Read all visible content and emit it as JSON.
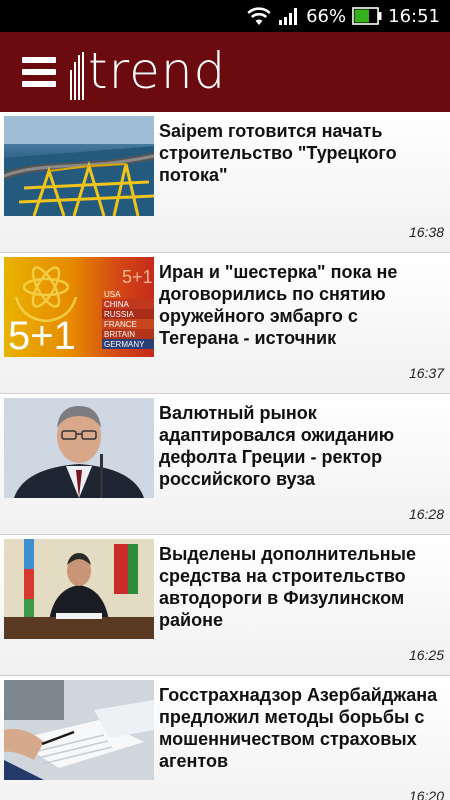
{
  "status_bar": {
    "wifi_icon": "wifi-icon",
    "signal_icon": "cell-signal-icon",
    "battery_percent": "66%",
    "battery_level": 0.66,
    "battery_icon": "battery-charging-icon",
    "time": "16:51"
  },
  "app_bar": {
    "menu_icon": "hamburger-menu-icon",
    "logo_text": "trend",
    "background_color": "#6b0a0f"
  },
  "news": [
    {
      "headline": "Saipem готовится начать строительство \"Турецкого потока\"",
      "time": "16:38",
      "thumb": "pipeline-construction-photo"
    },
    {
      "headline": "Иран и \"шестерка\" пока не договорились по снятию оружейного эмбарго с Тегерана - источник",
      "time": "16:37",
      "thumb": "iaea-5-plus-1-graphic",
      "thumb_text": {
        "big": "5+1",
        "small": "5+1",
        "countries": [
          "USA",
          "CHINA",
          "RUSSIA",
          "FRANCE",
          "BRITAIN",
          "GERMANY"
        ]
      }
    },
    {
      "headline": "Валютный рынок адаптировался ожиданию дефолта Греции - ректор российского вуза",
      "time": "16:28",
      "thumb": "man-portrait-photo"
    },
    {
      "headline": "Выделены дополнительные средства на строительство автодороги в Физулинском районе",
      "time": "16:25",
      "thumb": "president-at-desk-photo"
    },
    {
      "headline": "Госстрахнадзор Азербайджана предложил методы борьбы с мошенничеством страховых агентов",
      "time": "16:20",
      "thumb": "documents-signing-photo"
    }
  ]
}
